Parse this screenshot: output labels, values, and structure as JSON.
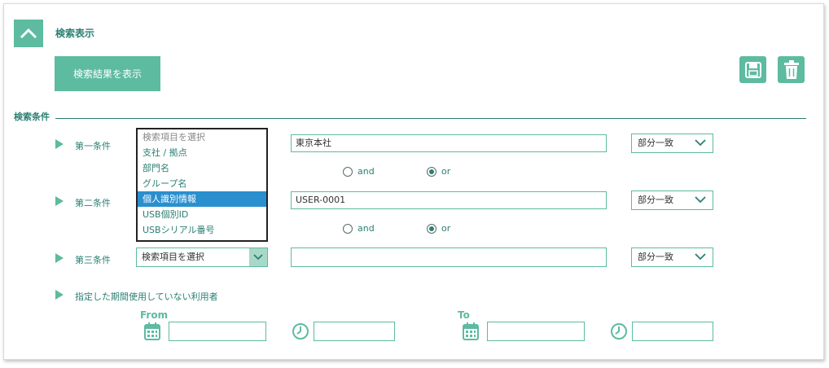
{
  "header": {
    "title": "検索表示"
  },
  "toolbar": {
    "search_label": "検索結果を表示",
    "save_icon": "save-icon",
    "delete_icon": "trash-icon"
  },
  "section": {
    "label": "検索条件"
  },
  "conditions": [
    {
      "label": "第一条件",
      "value": "東京本社",
      "match": "部分一致"
    },
    {
      "label": "第二条件",
      "value": "USER-0001",
      "match": "部分一致"
    },
    {
      "label": "第三条件",
      "value": "",
      "match": "部分一致",
      "field_select": "検索項目を選択"
    }
  ],
  "logic": [
    {
      "and": "and",
      "or": "or",
      "selected": "or"
    },
    {
      "and": "and",
      "or": "or",
      "selected": "or"
    }
  ],
  "dropdown": {
    "items": [
      "検索項目を選択",
      "支社 / 拠点",
      "部門名",
      "グループ名",
      "個人識別情報",
      "USB個別ID",
      "USBシリアル番号"
    ],
    "selected": "個人識別情報"
  },
  "period": {
    "label": "指定した期間使用していない利用者",
    "from_label": "From",
    "to_label": "To"
  },
  "colors": {
    "accent": "#5dbba0",
    "accent_dark": "#2a7f73",
    "selected": "#2a8fcf"
  }
}
